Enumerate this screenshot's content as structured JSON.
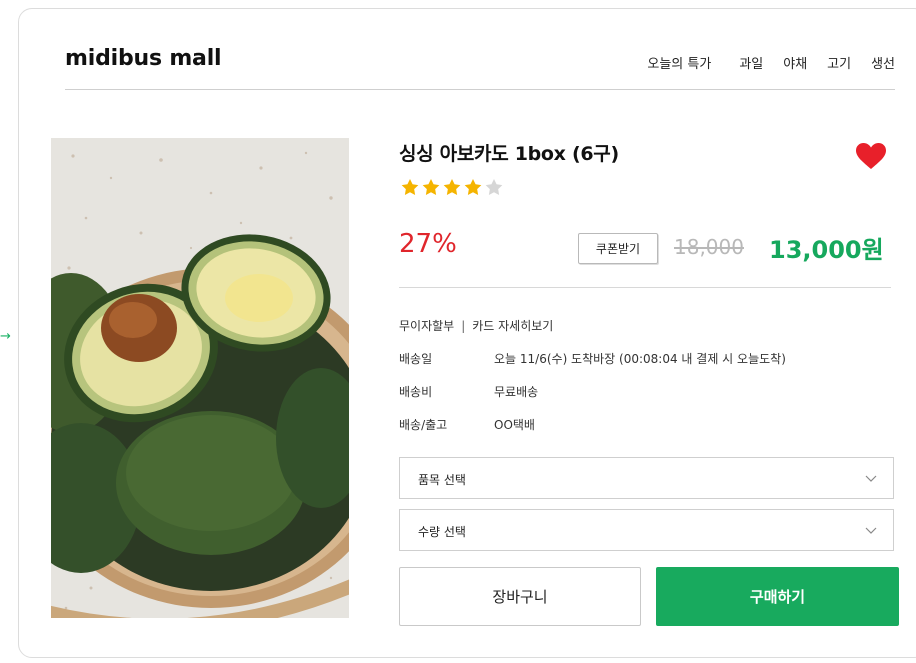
{
  "header": {
    "logo": "midibus mall",
    "nav": [
      "오늘의 특가",
      "과일",
      "야채",
      "고기",
      "생선"
    ]
  },
  "product": {
    "title": "싱싱 아보카도 1box (6구)",
    "rating": 4,
    "rating_max": 5,
    "discount": "27%",
    "coupon_label": "쿠폰받기",
    "original_price": "18,000",
    "sale_price": "13,000원",
    "favorited": true
  },
  "details": {
    "installment": "무이자할부",
    "separator": "|",
    "card_link": "카드 자세히보기",
    "rows": [
      {
        "label": "배송일",
        "value": "오늘 11/6(수) 도착바장 (00:08:04 내 결제 시 오늘도착)"
      },
      {
        "label": "배송비",
        "value": "무료배송"
      },
      {
        "label": "배송/출고",
        "value": "OO택배"
      }
    ]
  },
  "selects": {
    "item": "품목 선택",
    "quantity": "수량 선택"
  },
  "buttons": {
    "cart": "장바구니",
    "buy": "구매하기"
  },
  "colors": {
    "accent_green": "#18aa5e",
    "discount_red": "#e0262c",
    "heart_red": "#e8202a",
    "star_gold": "#f5b400"
  },
  "icons": {
    "favorite": "heart-icon",
    "dropdown": "chevron-down-icon",
    "rating": "star-icon"
  }
}
